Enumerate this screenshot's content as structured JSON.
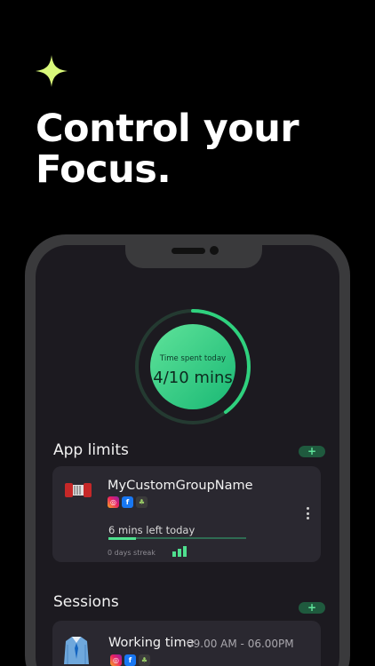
{
  "headline": {
    "line1": "Control your",
    "line2": "Focus."
  },
  "timer": {
    "label": "Time spent today",
    "value": "4/10 mins",
    "progress": 0.4
  },
  "app_limits": {
    "title": "App limits",
    "add_label": "+",
    "group": {
      "name": "MyCustomGroupName",
      "apps": [
        "instagram-icon",
        "facebook-icon",
        "game-icon"
      ],
      "time_left": "6 mins left today",
      "time_left_progress": 0.2,
      "streak": "0 days streak"
    }
  },
  "sessions": {
    "title": "Sessions",
    "add_label": "+",
    "session": {
      "name": "Working time",
      "time": "09.00 AM - 06.00PM",
      "apps": [
        "instagram-icon",
        "facebook-icon",
        "game-icon"
      ]
    }
  },
  "colors": {
    "accent": "#4fe08f",
    "sparkle": "#d9f97a",
    "background": "#000000"
  }
}
